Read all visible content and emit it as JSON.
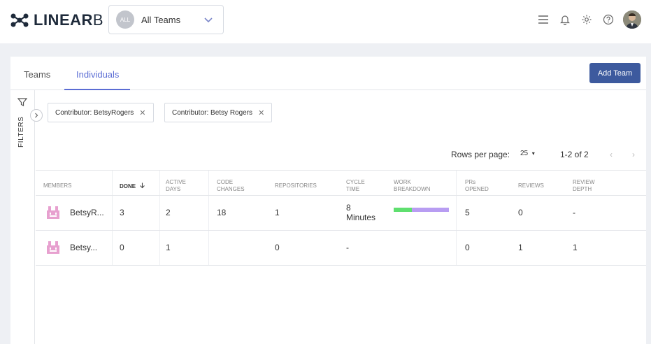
{
  "brand": {
    "logo_prefix": "LINEAR",
    "logo_suffix": "B"
  },
  "team_selector": {
    "badge": "ALL",
    "label": "All Teams"
  },
  "tabs": [
    {
      "label": "Teams",
      "active": false
    },
    {
      "label": "Individuals",
      "active": true
    }
  ],
  "add_team_label": "Add Team",
  "filters_label": "FILTERS",
  "chips": [
    {
      "label": "Contributor: BetsyRogers",
      "close": "✕"
    },
    {
      "label": "Contributor: Betsy Rogers",
      "close": "✕"
    }
  ],
  "pagination": {
    "rows_label": "Rows per page:",
    "rows_value": "25",
    "range": "1-2 of 2",
    "prev": "‹",
    "next": "›"
  },
  "columns": {
    "members": "MEMBERS",
    "done": "DONE",
    "active_days": [
      "ACTIVE",
      "DAYS"
    ],
    "code_changes": [
      "CODE",
      "CHANGES"
    ],
    "repositories": "REPOSITORIES",
    "cycle_time": [
      "CYCLE",
      "TIME"
    ],
    "work_breakdown": [
      "WORK",
      "BREAKDOWN"
    ],
    "prs_opened": [
      "PRs",
      "OPENED"
    ],
    "reviews": "REVIEWS",
    "review_depth": [
      "REVIEW",
      "DEPTH"
    ]
  },
  "rows": [
    {
      "member": "BetsyR...",
      "done": "3",
      "active_days": "2",
      "code_changes": "18",
      "repositories": "1",
      "cycle_time": [
        "8",
        "Minutes"
      ],
      "work_breakdown": [
        0.33,
        0.67
      ],
      "prs_opened": "5",
      "reviews": "0",
      "review_depth": "-"
    },
    {
      "member": "Betsy...",
      "done": "0",
      "active_days": "1",
      "code_changes": "",
      "repositories": "0",
      "cycle_time": [
        "-",
        ""
      ],
      "work_breakdown": null,
      "prs_opened": "0",
      "reviews": "1",
      "review_depth": "1"
    }
  ],
  "colors": {
    "accent": "#5b6dd4",
    "button": "#3d5a9e",
    "wb_new": "#5fdf6f",
    "wb_rework": "#b89df2",
    "avatar": "#e7a0cf"
  }
}
